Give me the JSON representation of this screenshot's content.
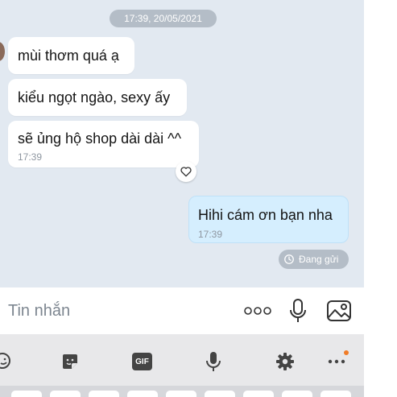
{
  "chat": {
    "date_separator": "17:39, 20/05/2021",
    "incoming": [
      {
        "text": "mùi thơm quá ạ"
      },
      {
        "text": "kiểu ngọt ngào, sexy ấy"
      },
      {
        "text": "sẽ ủng hộ shop dài dài ^^",
        "time": "17:39"
      }
    ],
    "outgoing": {
      "text": "Hihi cám ơn bạn nha",
      "time": "17:39"
    },
    "status": "Đang gửi"
  },
  "composer": {
    "placeholder": "Tin nhắn",
    "icons": [
      "more-options-icon",
      "microphone-icon",
      "image-icon"
    ]
  },
  "keyboard_toolbar": {
    "gif_label": "GIF",
    "icons": [
      "emoji-icon",
      "sticker-icon",
      "gif-icon",
      "voice-input-icon",
      "settings-icon",
      "more-icon"
    ],
    "notification_dot_color": "#f07c28"
  },
  "colors": {
    "chat_background": "#e2e9f1",
    "outgoing_bubble": "#d5eefe",
    "pill": "#b4bdc7"
  }
}
